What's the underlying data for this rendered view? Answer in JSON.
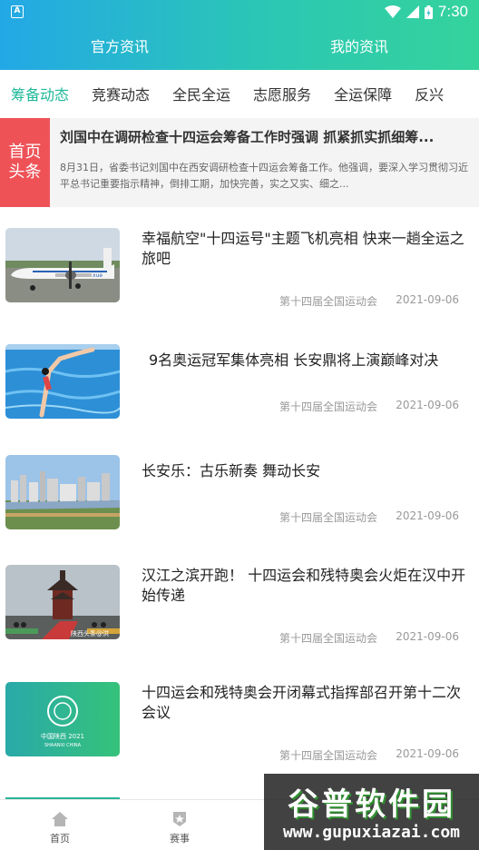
{
  "status_bar": {
    "time": "7:30",
    "app_icon": "A"
  },
  "top_tabs": [
    {
      "label": "官方资讯"
    },
    {
      "label": "我的资讯"
    }
  ],
  "category_tabs": [
    {
      "label": "筹备动态",
      "active": true
    },
    {
      "label": "竞赛动态"
    },
    {
      "label": "全民全运"
    },
    {
      "label": "志愿服务"
    },
    {
      "label": "全运保障"
    },
    {
      "label": "反兴"
    }
  ],
  "headline": {
    "badge_line1": "首页",
    "badge_line2": "头条",
    "title": "刘国中在调研检查十四运会筹备工作时强调 抓紧抓实抓细筹...",
    "body": "8月31日，省委书记刘国中在西安调研检查十四运会筹备工作。他强调，要深入学习贯彻习近平总书记重要指示精神，倒排工期，加快完善，实之又实、细之..."
  },
  "news": [
    {
      "title": "幸福航空\"十四运号\"主题飞机亮相 快来一趟全运之旅吧",
      "source": "第十四届全国运动会",
      "date": "2021-09-06"
    },
    {
      "title": "9名奥运冠军集体亮相 长安鼎将上演巅峰对决",
      "source": "第十四届全国运动会",
      "date": "2021-09-06"
    },
    {
      "title": "长安乐：古乐新奏 舞动长安",
      "source": "第十四届全国运动会",
      "date": "2021-09-06"
    },
    {
      "title": "汉江之滨开跑！ 十四运会和残特奥会火炬在汉中开始传递",
      "source": "第十四届全国运动会",
      "date": "2021-09-06"
    },
    {
      "title": "十四运会和残特奥会开闭幕式指挥部召开第十二次会议",
      "source": "第十四届全国运动会",
      "date": "2021-09-06"
    }
  ],
  "thumb_texts": {
    "plane_tail": "xue",
    "torch_watermark": "陕西头条@洪",
    "logo_line1": "中国陕西 2021",
    "logo_line2": "SHAANXI CHINA"
  },
  "bottom_nav": [
    {
      "label": "首页",
      "icon": "home-icon"
    },
    {
      "label": "赛事",
      "icon": "medal-icon"
    }
  ],
  "watermark": {
    "title": "谷普软件园",
    "url": "www.gupuxiazai.com"
  },
  "colors": {
    "accent": "#1fb99a",
    "header_start": "#23a8e6",
    "header_end": "#35d39c",
    "badge": "#ee5257"
  }
}
